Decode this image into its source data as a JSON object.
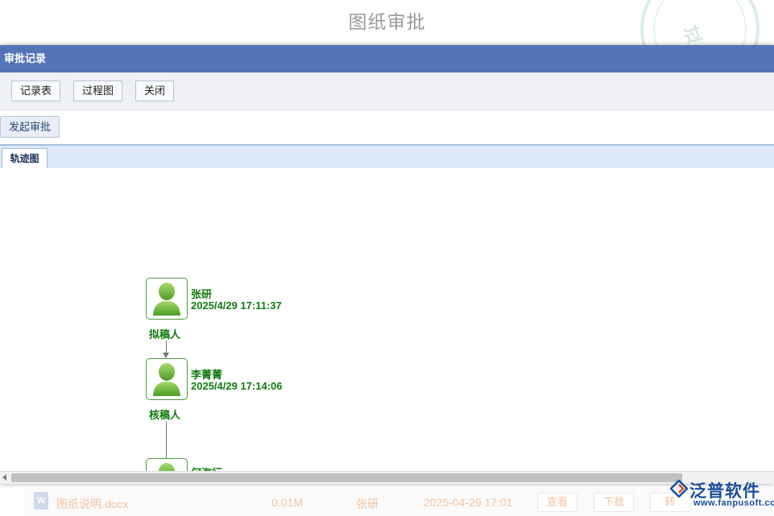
{
  "page_title": "图纸审批",
  "stamp_text": "过",
  "dialog": {
    "title": "审批记录",
    "toolbar": {
      "record_table": "记录表",
      "process_chart": "过程图",
      "close": "关闭"
    },
    "launch_label": "发起审批",
    "tab_label": "轨迹图",
    "nodes": [
      {
        "name": "张研",
        "time": "2025/4/29 17:11:37",
        "role": "拟稿人"
      },
      {
        "name": "李菁菁",
        "time": "2025/4/29 17:14:06",
        "role": "核稿人"
      },
      {
        "name": "何海行"
      }
    ]
  },
  "file_row": {
    "icon_letter": "W",
    "file_name": "图纸说明.docx",
    "size": "0.01M",
    "uploader": "张研",
    "date": "2025-04-29 17:01",
    "view": "查看",
    "download": "下载",
    "transfer": "转"
  },
  "logo": {
    "name": "泛普软件",
    "url": "www.fanpusoft.com"
  }
}
